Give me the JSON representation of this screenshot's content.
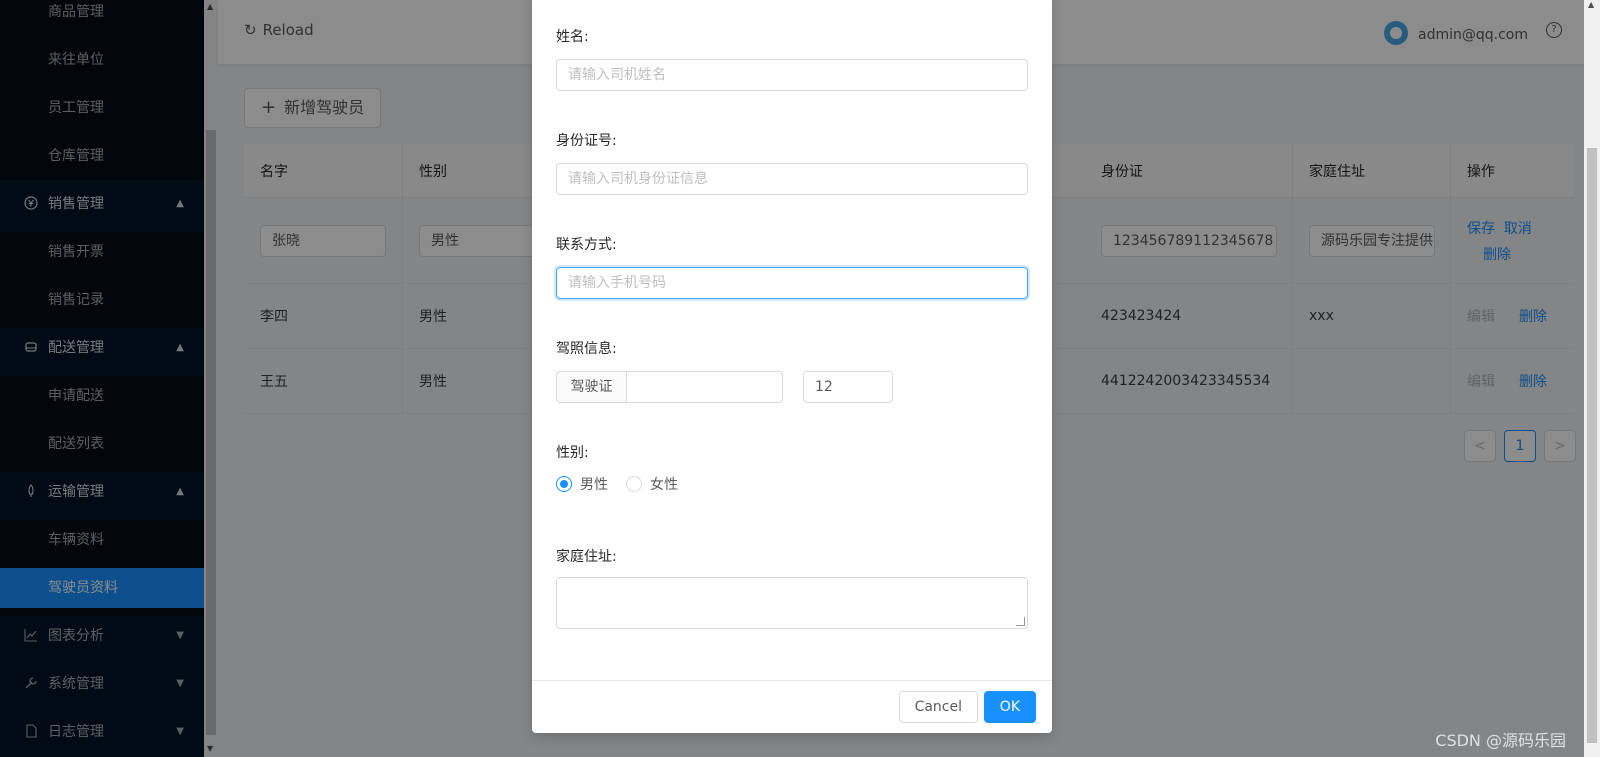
{
  "sidebar": {
    "items": [
      {
        "label": "商品管理"
      },
      {
        "label": "来往单位"
      },
      {
        "label": "员工管理"
      },
      {
        "label": "仓库管理"
      },
      {
        "label": "销售管理"
      },
      {
        "label": "销售开票"
      },
      {
        "label": "销售记录"
      },
      {
        "label": "配送管理"
      },
      {
        "label": "申请配送"
      },
      {
        "label": "配送列表"
      },
      {
        "label": "运输管理"
      },
      {
        "label": "车辆资料"
      },
      {
        "label": "驾驶员资料"
      },
      {
        "label": "图表分析"
      },
      {
        "label": "系统管理"
      },
      {
        "label": "日志管理"
      }
    ]
  },
  "header": {
    "reload_label": "Reload",
    "user_email": "admin@qq.com",
    "help_glyph": "?"
  },
  "toolbar": {
    "add_driver_label": "新增驾驶员"
  },
  "table": {
    "columns": [
      "名字",
      "性别",
      "身份证",
      "家庭住址",
      "操作"
    ],
    "editing_row": {
      "name": "张晓",
      "gender": "男性",
      "id_card": "123456789112345678",
      "address": "源码乐园专注提供",
      "save": "保存",
      "cancel": "取消",
      "delete": "删除"
    },
    "rows": [
      {
        "name": "李四",
        "gender": "男性",
        "id_card": "423423424",
        "address": "xxx",
        "edit": "编辑",
        "delete": "删除"
      },
      {
        "name": "王五",
        "gender": "男性",
        "id_card": "4412242003423345534",
        "address": "",
        "edit": "编辑",
        "delete": "删除"
      }
    ]
  },
  "pagination": {
    "prev": "<",
    "current": "1",
    "next": ">"
  },
  "modal": {
    "name_label": "姓名:",
    "name_placeholder": "请输入司机姓名",
    "idcard_label": "身份证号:",
    "idcard_placeholder": "请输入司机身份证信息",
    "phone_label": "联系方式:",
    "phone_placeholder": "请输入手机号码",
    "license_label": "驾照信息:",
    "license_addon": "驾驶证",
    "license_years": "12",
    "gender_label": "性别:",
    "gender_male": "男性",
    "gender_female": "女性",
    "address_label": "家庭住址:",
    "cancel_label": "Cancel",
    "ok_label": "OK"
  },
  "watermark": "CSDN @源码乐园",
  "colors": {
    "primary": "#1890ff",
    "sidebar_bg": "#001529"
  }
}
